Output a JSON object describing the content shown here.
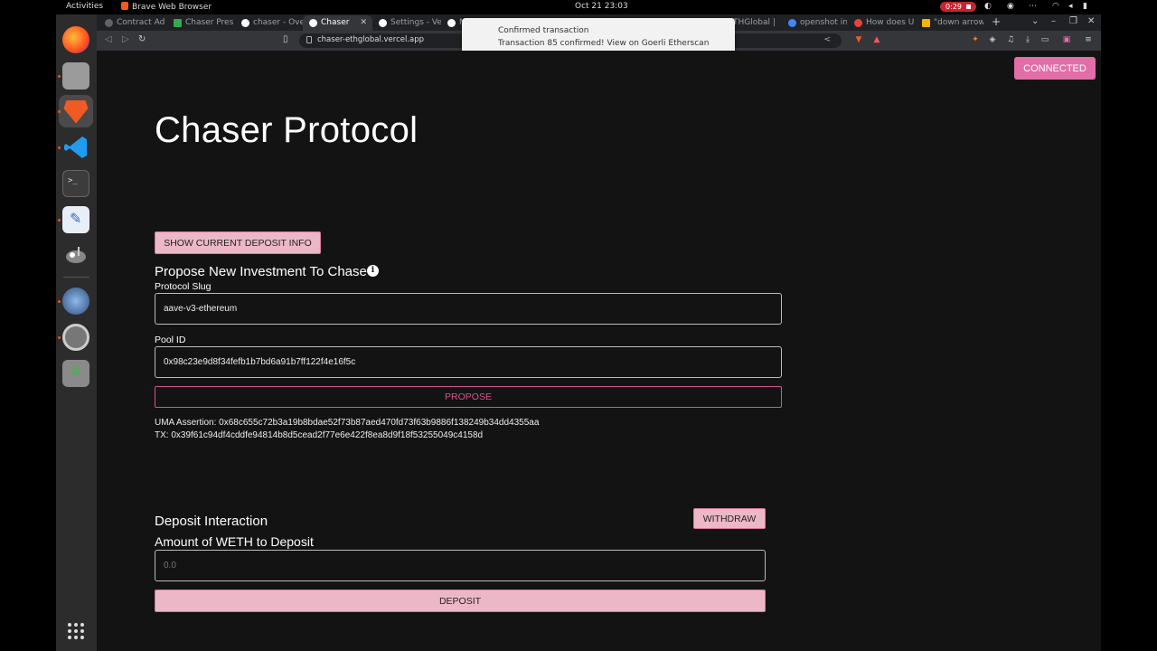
{
  "topbar": {
    "activities": "Activities",
    "app_name": "Brave Web Browser",
    "clock": "Oct 21  23:03",
    "recording_time": "0:29"
  },
  "dock": {
    "items": [
      "firefox-icon",
      "files-icon",
      "brave-icon",
      "vscode-icon",
      "terminal-icon",
      "text-editor-icon",
      "gimp-icon",
      "disk-icon",
      "settings-icon",
      "trash-icon"
    ]
  },
  "browser": {
    "tabs": [
      {
        "label": "Contract Ad",
        "favicon_color": "#5f6368"
      },
      {
        "label": "Chaser Pres",
        "favicon_color": "#34a853"
      },
      {
        "label": "chaser - Ove",
        "favicon_color": "#ffffff"
      },
      {
        "label": "Chaser",
        "favicon_color": "#ffffff"
      },
      {
        "label": "Settings - Ve",
        "favicon_color": "#ffffff"
      },
      {
        "label": "M",
        "favicon_color": "#ffffff"
      },
      {
        "label": "THGlobal |",
        "favicon_color": "#888888"
      },
      {
        "label": "openshot in",
        "favicon_color": "#4285f4"
      },
      {
        "label": "How does U",
        "favicon_color": "#ea4335"
      },
      {
        "label": "\"down arrow",
        "favicon_color": "#f4b400"
      }
    ],
    "url": "chaser-ethglobal.vercel.app"
  },
  "notification": {
    "title": "Confirmed transaction",
    "body": "Transaction 85 confirmed! View on Goerli Etherscan"
  },
  "page": {
    "connected_label": "CONNECTED",
    "title": "Chaser Protocol",
    "show_deposit_label": "SHOW CURRENT DEPOSIT INFO",
    "propose_heading": "Propose New Investment To Chase",
    "protocol_slug_label": "Protocol Slug",
    "protocol_slug_value": "aave-v3-ethereum",
    "pool_id_label": "Pool ID",
    "pool_id_value": "0x98c23e9d8f34fefb1b7bd6a91b7ff122f4e16f5c",
    "propose_label": "PROPOSE",
    "uma_assertion": "UMA Assertion: 0x68c655c72b3a19b8bdae52f73b87aed470fd73f63b9886f138249b34dd4355aa",
    "tx": "TX: 0x39f61c94df4cddfe94814b8d5cead2f77e6e422f8ea8d9f18f53255049c4158d",
    "deposit_heading": "Deposit Interaction",
    "withdraw_label": "WITHDRAW",
    "amount_label": "Amount of WETH to Deposit",
    "amount_placeholder": "0.0",
    "deposit_label": "DEPOSIT"
  },
  "colors": {
    "accent_pink": "#e26ea8",
    "button_pink": "#ecb8c8",
    "page_bg": "#131313"
  }
}
